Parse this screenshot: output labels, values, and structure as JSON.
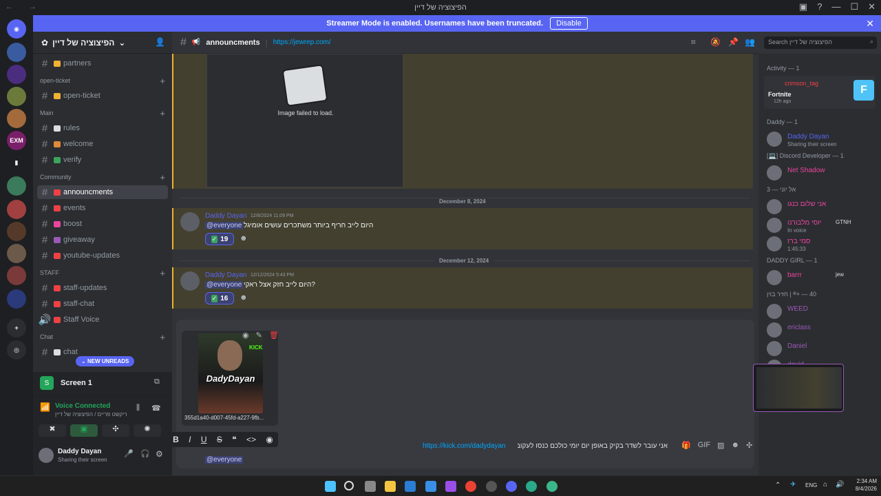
{
  "window": {
    "title": "הפיצוציה של דיין",
    "nav_arrows": "← →",
    "controls": [
      "▣",
      "?",
      "—",
      "☐",
      "✕"
    ]
  },
  "banner": {
    "text": "Streamer Mode is enabled. Usernames have been truncated.",
    "button": "Disable",
    "close": "✕"
  },
  "guilds": [
    {
      "badge": "104",
      "color": "#5865f2",
      "glyph": "◉"
    },
    {
      "badge": "151",
      "color": "#3a5ba0",
      "glyph": ""
    },
    {
      "badge": "10",
      "color": "#4b2d7f",
      "glyph": ""
    },
    {
      "badge": "",
      "color": "#6b7a3a",
      "glyph": ""
    },
    {
      "badge": "",
      "color": "#a36a3b",
      "glyph": ""
    },
    {
      "badge": "29",
      "color": "#7a1f6a",
      "glyph": "EXM"
    },
    {
      "badge": "",
      "color": "#1e1f22",
      "glyph": "▮"
    },
    {
      "badge": "208",
      "color": "#3b7a5a",
      "glyph": ""
    },
    {
      "badge": "3",
      "color": "#a04040",
      "glyph": ""
    },
    {
      "badge": "21",
      "color": "#553a2a",
      "glyph": ""
    },
    {
      "badge": "184",
      "color": "#6b5a4a",
      "glyph": ""
    },
    {
      "badge": "4K+",
      "color": "#7a3a3a",
      "glyph": ""
    },
    {
      "badge": "1K+",
      "color": "#2a3a7a",
      "glyph": ""
    },
    {
      "badge": "",
      "color": "#2b2d31",
      "glyph": "+"
    },
    {
      "badge": "",
      "color": "#2b2d31",
      "glyph": "◎"
    }
  ],
  "server": {
    "name": "הפיצוציה של דיין",
    "chevron": "⌄"
  },
  "channels": [
    {
      "type": "text",
      "label": "partners",
      "emoji_color": "#f0b232"
    },
    {
      "type": "category",
      "label": "open-ticket"
    },
    {
      "type": "text",
      "label": "open-ticket",
      "emoji_color": "#f0b232"
    },
    {
      "type": "category",
      "label": "Main"
    },
    {
      "type": "text",
      "label": "rules",
      "emoji_color": "#dbdee1"
    },
    {
      "type": "text",
      "label": "welcome",
      "emoji_color": "#e08a3a"
    },
    {
      "type": "text",
      "label": "verify",
      "emoji_color": "#3ba55d"
    },
    {
      "type": "category",
      "label": "Community"
    },
    {
      "type": "text",
      "label": "announcments",
      "emoji_color": "#ed4245",
      "active": true
    },
    {
      "type": "text",
      "label": "events",
      "emoji_color": "#ed4245"
    },
    {
      "type": "text",
      "label": "boost",
      "emoji_color": "#eb459e"
    },
    {
      "type": "text",
      "label": "giveaway",
      "emoji_color": "#9b59b6"
    },
    {
      "type": "text",
      "label": "youtube-updates",
      "emoji_color": "#ed4245"
    },
    {
      "type": "category",
      "label": "STAFF"
    },
    {
      "type": "text",
      "label": "staff-updates",
      "emoji_color": "#ed4245"
    },
    {
      "type": "text",
      "label": "staff-chat",
      "emoji_color": "#ed4245"
    },
    {
      "type": "voice",
      "label": "Staff Voice",
      "emoji_color": "#ed4245"
    },
    {
      "type": "category",
      "label": "Chat"
    },
    {
      "type": "text",
      "label": "chat",
      "emoji_color": "#dbdee1"
    }
  ],
  "new_unreads": "NEW UNREADS",
  "screen_panel": {
    "title": "Screen 1"
  },
  "voice": {
    "status": "Voice Connected",
    "location": "ריקשט פריים / הפיצוציה של דיין"
  },
  "user": {
    "name": "Daddy Dayan",
    "status": "Sharing their screen"
  },
  "channel_header": {
    "name": "announcments",
    "topic_link": "https://jewrep.com/",
    "search_placeholder": "Search הפיצוציה של דיין"
  },
  "image_failed": "Image failed to load.",
  "messages": [
    {
      "date": "December 8, 2024",
      "author": "Daddy Dayan",
      "timestamp": "12/8/2024 11:09 PM",
      "mention": "@everyone",
      "text": "היום לייב חריף ביותר משתכרים עושים אומיגל",
      "reaction_count": "19"
    },
    {
      "date": "December 12, 2024",
      "author": "Daddy Dayan",
      "timestamp": "12/12/2024 5:43 PM",
      "mention": "@everyone",
      "text": "היום לייב חזק אצל ראקי?",
      "reaction_count": "16"
    }
  ],
  "attachment": {
    "filename": "355d1a40-d007-45fd-a227-9fb...",
    "poster_title": "DadyDayan",
    "poster_sub": "KICK"
  },
  "composer": {
    "link": "https://kick.com/dadydayan",
    "text": "אני עובר לשדר בקיק באופן יום יומי כולכם כנסו לעקוב :",
    "mention": "@everyone",
    "format_buttons": [
      "B",
      "I",
      "U",
      "S",
      "❝",
      "<>",
      "◉"
    ]
  },
  "members": {
    "activity_header": "Activity — 1",
    "activity": {
      "game": "Fortnite",
      "time": "12h ago",
      "name": "crimson_tag"
    },
    "groups": [
      {
        "header": "Daddy — 1",
        "members": [
          {
            "name": "Daddy Dayan",
            "sub": "Sharing their screen",
            "color": "#5865f2"
          }
        ]
      },
      {
        "header": "[💻] Discord Developer — 1",
        "members": [
          {
            "name": "Net Shadow",
            "sub": "",
            "color": "#eb459e"
          }
        ]
      },
      {
        "header": "אל יוני — 3",
        "members": [
          {
            "name": "אני שלום כנגו",
            "sub": "",
            "color": "#eb459e"
          },
          {
            "name": "יוסי מלבורנו",
            "sub": "In voice",
            "tag": "GTNH",
            "color": "#eb459e"
          },
          {
            "name": "סמי ברז",
            "sub": "1:45:33",
            "color": "#eb459e"
          }
        ]
      },
      {
        "header": "DADDY GIRL — 1",
        "members": [
          {
            "name": "barrr",
            "sub": "",
            "tag": "jew",
            "color": "#eb459e"
          }
        ]
      },
      {
        "header": "חזיר בוין | ᴵᴵᴵ+ — 40",
        "members": [
          {
            "name": "WEED",
            "sub": "",
            "color": "#9b59b6"
          },
          {
            "name": "ericlass",
            "sub": "",
            "color": "#9b59b6"
          },
          {
            "name": "Daniel",
            "sub": "",
            "color": "#9b59b6"
          },
          {
            "name": "david",
            "sub": "Fortnite",
            "color": "#9b59b6"
          },
          {
            "name": "d...",
            "sub": "",
            "color": "#9b59b6"
          }
        ]
      }
    ]
  },
  "taskbar": {
    "lang": "ENG",
    "time": "2:34 AM",
    "date": "8/4/2026"
  }
}
